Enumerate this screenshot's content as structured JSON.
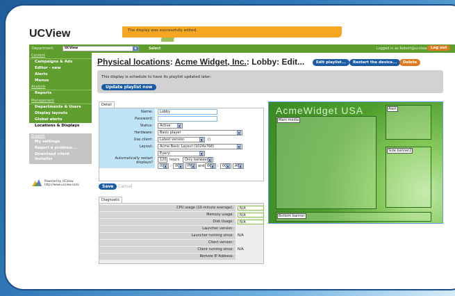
{
  "app": {
    "logo": "UCView",
    "flash": "The display was successfully edited."
  },
  "topbar": {
    "department_label": "Department:",
    "department_value": "UCView",
    "select_label": "Select",
    "logged_in": "Logged in as Robert@ucview.com",
    "logout": "Log out"
  },
  "sidebar": {
    "content_group": "Content",
    "content_items": [
      "Campaigns & Ads",
      "Editor - new",
      "Alerts",
      "Menus"
    ],
    "analysis_group": "Analysis",
    "analysis_items": [
      "Reports"
    ],
    "management_group": "Management",
    "management_items": [
      "Departments & Users",
      "Display layouts",
      "Global alerts",
      "Locations & Displays"
    ],
    "support_group": "Support",
    "support_items": [
      "My settings",
      "Report a problem...",
      "Download client installer"
    ],
    "powered_line1": "Powered by UCView",
    "powered_line2": "http://www.ucview.com/"
  },
  "heading": {
    "part1": "Physical locations",
    "sep": ": ",
    "part2": "Acme Widget, Inc.",
    "part3": ": Lobby: Edit...",
    "edit_playlist": "Edit playlist...",
    "restart": "Restart the device...",
    "delete": "Delete"
  },
  "notice": {
    "text": "This display is schedule to have its playlist updated later:",
    "button": "Update playlist now"
  },
  "detail": {
    "tab": "Detail",
    "name_label": "Name:",
    "name_value": "Lobby",
    "password_label": "Password:",
    "password_value": "",
    "status_label": "Status:",
    "status_value": "Active",
    "hardware_label": "Hardware:",
    "hardware_value": "Basic player",
    "client_label": "Use client:",
    "client_value": "Latest version",
    "client_extra": "()",
    "layout_label": "Layout:",
    "layout_value": "Acme Basic Layout (1024x768)",
    "restart_label": "Automatically restart displays?",
    "restart_every": "Every:",
    "restart_hours": "120",
    "restart_hours_text": "hours",
    "restart_only": "Only between:",
    "t1_h": "09",
    "t1_m": "00",
    "t1_ap": "PM",
    "and": "and",
    "t2_h": "06",
    "t2_m": "00",
    "t2_ap": "AM"
  },
  "actions": {
    "save": "Save",
    "cancel": "Cancel"
  },
  "diagnostic": {
    "tab": "Diagnostic",
    "rows": [
      {
        "label": "CPU usage (10-minute average):",
        "value": "N/A",
        "boxed": true
      },
      {
        "label": "Memory usage:",
        "value": "N/A",
        "boxed": true
      },
      {
        "label": "Disk Usage:",
        "value": "N/A",
        "boxed": true
      },
      {
        "label": "Launcher version:",
        "value": "",
        "boxed": false
      },
      {
        "label": "Launcher running since:",
        "value": "N/A",
        "boxed": false
      },
      {
        "label": "Client version:",
        "value": "",
        "boxed": false
      },
      {
        "label": "Client running since:",
        "value": "N/A",
        "boxed": false
      },
      {
        "label": "Remote IP Address:",
        "value": "",
        "boxed": false
      }
    ]
  },
  "preview": {
    "brand": "AcmeWidget USA",
    "zones": [
      "Main media",
      "Alert",
      "Side banner2",
      "Bottom banner"
    ]
  },
  "colors": {
    "green": "#5f9d2f",
    "blue_button": "#1b5aa4",
    "orange": "#e07a1f",
    "flash": "#f5a623"
  }
}
